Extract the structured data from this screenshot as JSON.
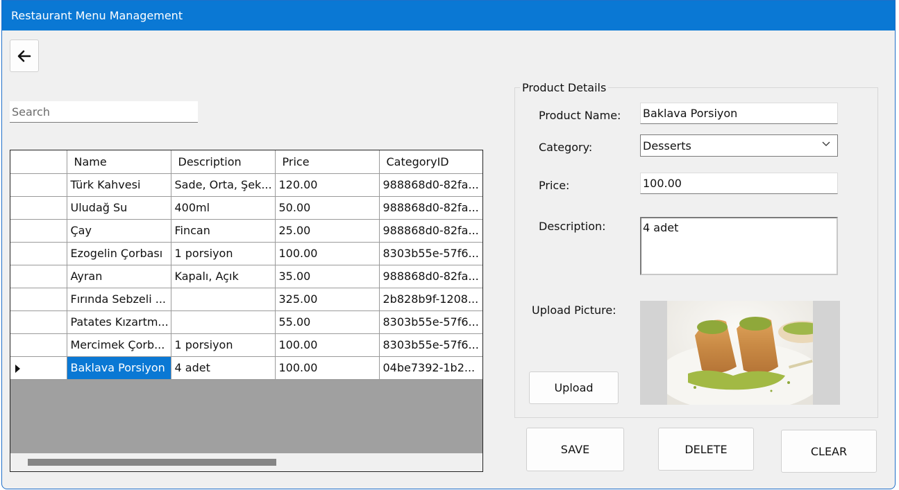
{
  "window": {
    "title": "Restaurant Menu Management"
  },
  "search": {
    "placeholder": "Search",
    "value": ""
  },
  "grid": {
    "columns": [
      "Name",
      "Description",
      "Price",
      "CategoryID"
    ],
    "rows": [
      [
        "Türk Kahvesi",
        "Sade, Orta, Şek...",
        "120.00",
        "988868d0-82fa..."
      ],
      [
        "Uludağ Su",
        "400ml",
        "50.00",
        "988868d0-82fa..."
      ],
      [
        "Çay",
        "Fincan",
        "25.00",
        "988868d0-82fa..."
      ],
      [
        "Ezogelin Çorbası",
        "1 porsiyon",
        "100.00",
        "8303b55e-57f6..."
      ],
      [
        "Ayran",
        "Kapalı, Açık",
        "35.00",
        "988868d0-82fa..."
      ],
      [
        "Fırında Sebzeli ...",
        "",
        "325.00",
        "2b828b9f-1208..."
      ],
      [
        "Patates Kızartm...",
        "",
        "55.00",
        "8303b55e-57f6..."
      ],
      [
        "Mercimek Çorb...",
        "1 porsiyon",
        "100.00",
        "8303b55e-57f6..."
      ],
      [
        "Baklava Porsiyon",
        "4 adet",
        "100.00",
        "04be7392-1b2..."
      ]
    ],
    "selected_row_index": 8
  },
  "details": {
    "legend": "Product Details",
    "name_label": "Product Name:",
    "name_value": "Baklava Porsiyon",
    "category_label": "Category:",
    "category_value": "Desserts",
    "price_label": "Price:",
    "price_value": "100.00",
    "description_label": "Description:",
    "description_value": "4 adet",
    "picture_label": "Upload Picture:",
    "upload_label": "Upload"
  },
  "actions": {
    "save": "SAVE",
    "delete": "DELETE",
    "clear": "CLEAR"
  },
  "colors": {
    "titlebar": "#0a78d4",
    "selection": "#0a78d4",
    "grid_empty": "#a0a0a0"
  }
}
